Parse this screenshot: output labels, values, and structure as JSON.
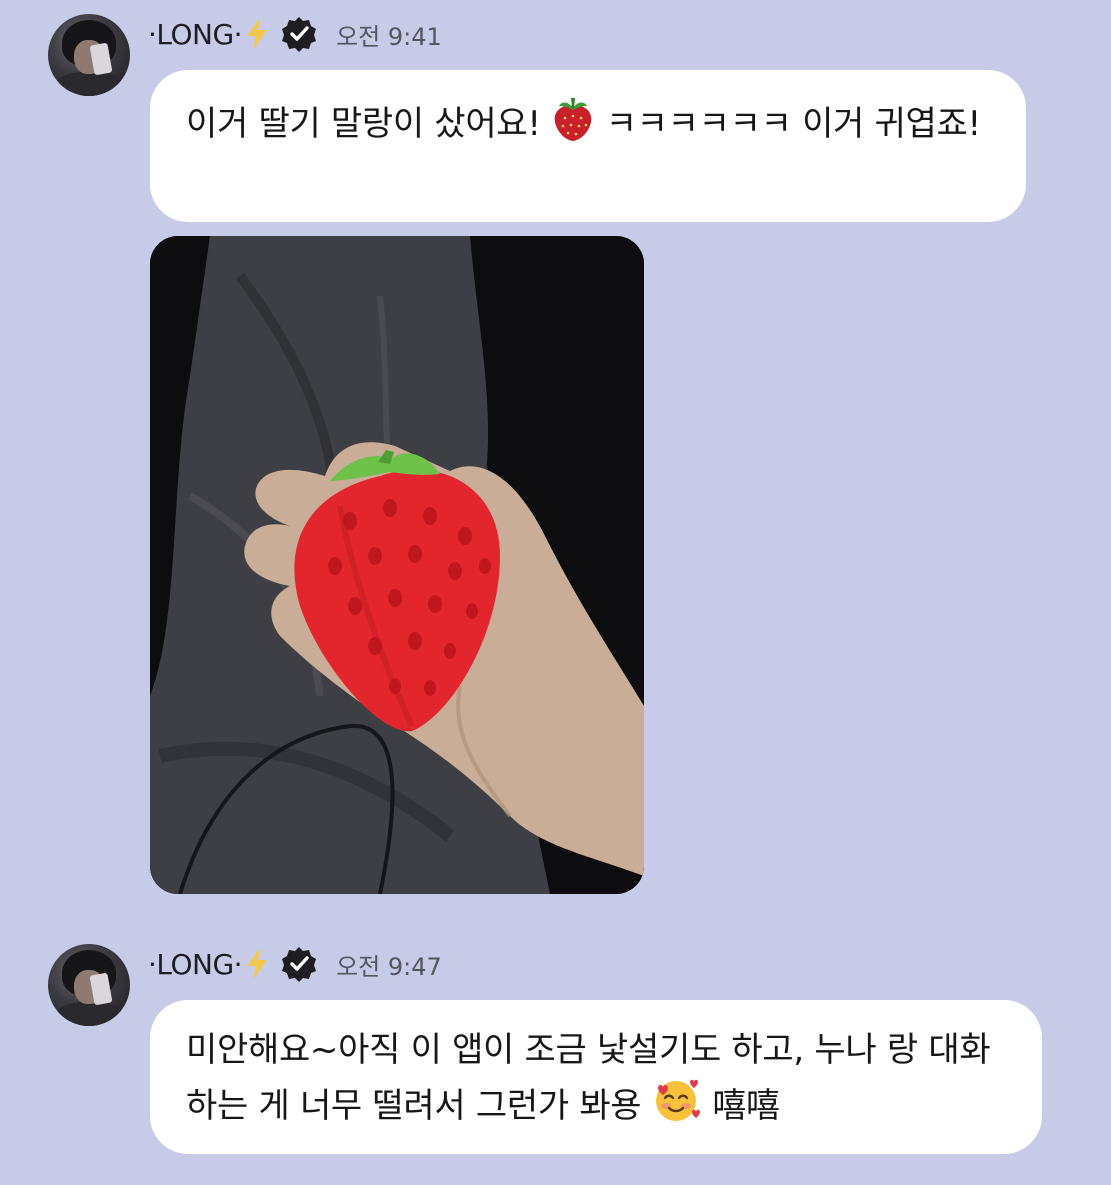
{
  "messages": [
    {
      "sender": "·LONG·",
      "time": "오전 9:41",
      "text_part1": "이거 딸기 말랑이 샀어요!",
      "text_part2": " ㅋㅋㅋㅋㅋㅋ 이거 귀엽죠!",
      "emoji": "strawberry-emoji"
    },
    {
      "sender": "·LONG·",
      "time": "오전 9:47",
      "text_part1": "미안해요~아직 이 앱이 조금 낯설기도 하고, 누나 랑 대화하는 게 너무 떨려서 그런가 봐용",
      "text_part2": " 嘻嘻",
      "emoji": "smiling-face-with-hearts-emoji"
    }
  ],
  "colors": {
    "background": "#c8cbe8",
    "bubble": "#ffffff",
    "bolt": "#f2c94c",
    "verified": "#1e1e22"
  }
}
